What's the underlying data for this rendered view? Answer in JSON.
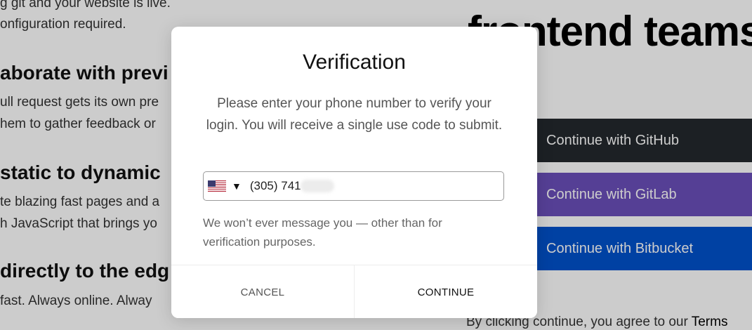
{
  "background": {
    "lines": [
      {
        "text": "g git and your website is live.",
        "kind": "text"
      },
      {
        "text": "onfiguration required.",
        "kind": "text"
      },
      {
        "text": "aborate with previ",
        "kind": "heading"
      },
      {
        "text": "ull request gets its own pre",
        "kind": "text"
      },
      {
        "text": "hem to gather feedback or",
        "kind": "text"
      },
      {
        "text": "static to dynamic",
        "kind": "heading"
      },
      {
        "text": "te blazing fast pages and a",
        "kind": "text"
      },
      {
        "text": "h JavaScript that brings yo",
        "kind": "text"
      },
      {
        "text": "directly to the edg",
        "kind": "heading"
      },
      {
        "text": "fast. Always online. Alway",
        "kind": "text"
      }
    ],
    "hero_title": "frontend teams",
    "login_buttons": [
      {
        "label": "Continue with GitHub",
        "color": "#24292e"
      },
      {
        "label": "Continue with GitLab",
        "color": "#6b4fbb"
      },
      {
        "label": "Continue with Bitbucket",
        "color": "#0052cc"
      }
    ],
    "legal": {
      "prefix": "By clicking continue, you agree to our ",
      "link": "Terms"
    }
  },
  "modal": {
    "title": "Verification",
    "description": "Please enter your phone number to verify your login. You will receive a single use code to submit.",
    "phone": {
      "country_icon": "us-flag-icon",
      "dropdown_icon": "caret-down-icon",
      "value": "(305) 741"
    },
    "helper": "We won’t ever message you — other than for verification purposes.",
    "cancel_label": "CANCEL",
    "continue_label": "CONTINUE"
  }
}
